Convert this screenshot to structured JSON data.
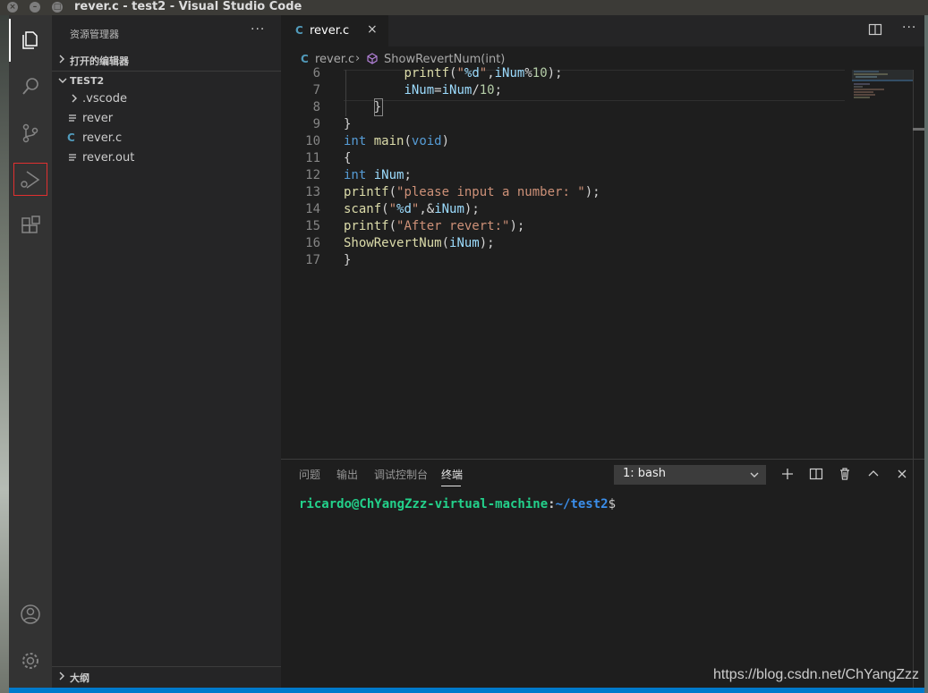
{
  "window": {
    "title": "rever.c - test2 - Visual Studio Code"
  },
  "sidebar": {
    "title": "资源管理器",
    "more": "···",
    "open_editors": "打开的编辑器",
    "folder": "TEST2",
    "files": [
      {
        "name": ".vscode",
        "kind": "folder"
      },
      {
        "name": "rever",
        "kind": "file"
      },
      {
        "name": "rever.c",
        "kind": "c"
      },
      {
        "name": "rever.out",
        "kind": "file"
      }
    ],
    "outline": "大纲"
  },
  "editor": {
    "tab_icon": "C",
    "tab_name": "rever.c",
    "tab_close": "×",
    "more": "···",
    "breadcrumb": {
      "icon": "C",
      "file": "rever.c",
      "sep": "›",
      "symbol": "ShowRevertNum(int)"
    },
    "line_numbers": [
      "6",
      "7",
      "8",
      "9",
      "10",
      "11",
      "12",
      "13",
      "14",
      "15",
      "16",
      "17"
    ]
  },
  "panel": {
    "tabs": [
      "问题",
      "输出",
      "调试控制台",
      "终端"
    ],
    "active_tab": "终端",
    "terminal_select": "1: bash",
    "prompt": {
      "user": "ricardo@ChYangZzz-virtual-machine",
      "sep": ":",
      "path": "~/test2",
      "end": "$"
    }
  },
  "watermark": "https://blog.csdn.net/ChYangZzz",
  "colors": {
    "accent": "#007acc",
    "activity": "#333333",
    "sidebar": "#252526",
    "editor": "#1e1e1e",
    "prompt_user": "#23d18b",
    "prompt_path": "#3b8eea"
  }
}
